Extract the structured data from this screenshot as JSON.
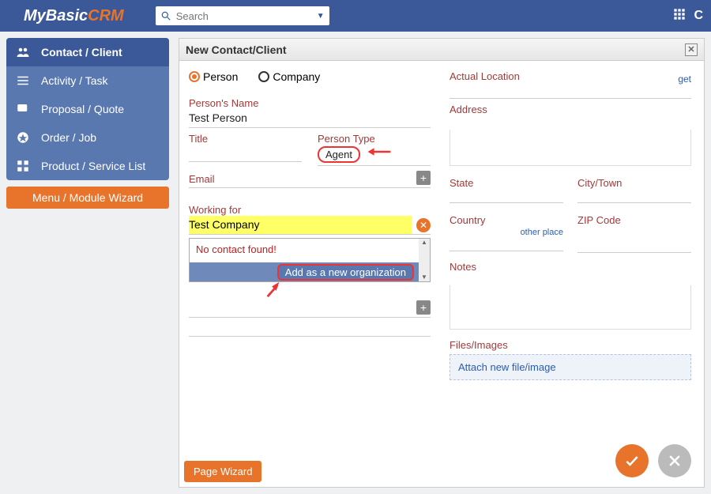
{
  "brand": {
    "part1": "MyBasic",
    "part2": "CRM"
  },
  "search": {
    "placeholder": "Search"
  },
  "topright": {
    "letter": "C"
  },
  "sidebar": {
    "items": [
      {
        "label": "Contact / Client",
        "icon": "contacts",
        "active": true
      },
      {
        "label": "Activity / Task",
        "icon": "activity"
      },
      {
        "label": "Proposal / Quote",
        "icon": "proposal"
      },
      {
        "label": "Order / Job",
        "icon": "order"
      },
      {
        "label": "Product / Service List",
        "icon": "product"
      }
    ],
    "wizard": "Menu / Module Wizard"
  },
  "panel": {
    "title": "New Contact/Client"
  },
  "form": {
    "radios": {
      "person": "Person",
      "company": "Company",
      "selected": "person"
    },
    "name_label": "Person's Name",
    "name_value": "Test Person",
    "title_label": "Title",
    "person_type_label": "Person Type",
    "person_type_value": "Agent",
    "email_label": "Email",
    "working_for_label": "Working for",
    "working_for_value": "Test Company",
    "no_contact": "No contact found!",
    "add_org": "Add as a new organization",
    "actual_location_label": "Actual Location",
    "get_link": "get",
    "address_label": "Address",
    "state_label": "State",
    "city_label": "City/Town",
    "country_label": "Country",
    "other_place": "other place",
    "zip_label": "ZIP Code",
    "notes_label": "Notes",
    "files_label": "Files/Images",
    "attach_label": "Attach new file/image"
  },
  "page_wizard_btn": "Page Wizard"
}
